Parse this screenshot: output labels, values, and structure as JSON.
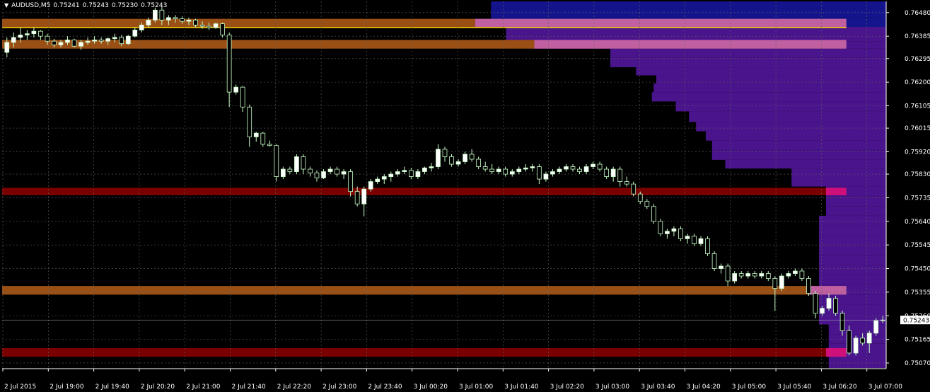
{
  "header": {
    "symbol_tf": "AUDUSD,M5",
    "open": "0.75241",
    "high": "0.75243",
    "low": "0.75230",
    "close": "0.75243",
    "dropdown_icon": "triangle-down-icon"
  },
  "colors": {
    "background": "#000000",
    "grid": "#606060",
    "axis_text": "#ffffff",
    "bull_body": "#ffffff",
    "bear_body": "#000000",
    "candle_wick": "#c8ffc8",
    "candle_outline": "#c8ffc8",
    "zone_orange": "#9a4f14",
    "zone_red": "#7a0000",
    "zone_pink": "#c060a0",
    "zone_magenta": "#d0107a",
    "profile_blue": "#14148c",
    "profile_purple": "#4a148c",
    "yellow_line": "#ffd700",
    "price_label_bg": "#ffffff"
  },
  "chart_data": {
    "type": "candlestick",
    "symbol": "AUDUSD",
    "timeframe": "M5",
    "ylim": [
      0.7505,
      0.76525
    ],
    "current_price": "0.75243",
    "y_ticks": [
      "0.76480",
      "0.76385",
      "0.76295",
      "0.76200",
      "0.76105",
      "0.76015",
      "0.75920",
      "0.75830",
      "0.75735",
      "0.75640",
      "0.75545",
      "0.75450",
      "0.75355",
      "0.75260",
      "0.75165",
      "0.75070"
    ],
    "x_ticks": [
      "2 Jul 2015",
      "2 Jul 19:00",
      "2 Jul 19:40",
      "2 Jul 20:20",
      "2 Jul 21:00",
      "2 Jul 21:40",
      "2 Jul 22:20",
      "2 Jul 23:00",
      "2 Jul 23:40",
      "3 Jul 00:20",
      "3 Jul 01:00",
      "3 Jul 01:40",
      "3 Jul 02:20",
      "3 Jul 03:00",
      "3 Jul 03:40",
      "3 Jul 04:20",
      "3 Jul 05:00",
      "3 Jul 05:40",
      "3 Jul 06:20",
      "3 Jul 07:00"
    ],
    "candles": [
      [
        0.7632,
        0.7638,
        0.763,
        0.7636
      ],
      [
        0.7636,
        0.764,
        0.7634,
        0.7638
      ],
      [
        0.7638,
        0.7642,
        0.7636,
        0.7639
      ],
      [
        0.7639,
        0.7641,
        0.7637,
        0.76395
      ],
      [
        0.76395,
        0.7642,
        0.7638,
        0.76405
      ],
      [
        0.76405,
        0.7641,
        0.7637,
        0.76385
      ],
      [
        0.76385,
        0.76395,
        0.7635,
        0.76365
      ],
      [
        0.76365,
        0.76375,
        0.7634,
        0.7635
      ],
      [
        0.7635,
        0.7637,
        0.7634,
        0.7636
      ],
      [
        0.7636,
        0.76385,
        0.7635,
        0.7637
      ],
      [
        0.7637,
        0.76375,
        0.7634,
        0.76345
      ],
      [
        0.76345,
        0.7637,
        0.7633,
        0.7636
      ],
      [
        0.7636,
        0.7638,
        0.7635,
        0.76365
      ],
      [
        0.76365,
        0.76385,
        0.76355,
        0.7637
      ],
      [
        0.7637,
        0.7638,
        0.76355,
        0.76365
      ],
      [
        0.76365,
        0.7638,
        0.7635,
        0.76375
      ],
      [
        0.76375,
        0.76395,
        0.7636,
        0.7638
      ],
      [
        0.7638,
        0.7639,
        0.76345,
        0.76355
      ],
      [
        0.76355,
        0.7639,
        0.7635,
        0.76385
      ],
      [
        0.76385,
        0.7642,
        0.7638,
        0.7641
      ],
      [
        0.7641,
        0.7644,
        0.764,
        0.7643
      ],
      [
        0.7643,
        0.7646,
        0.7642,
        0.7645
      ],
      [
        0.7645,
        0.765,
        0.7644,
        0.7649
      ],
      [
        0.7649,
        0.76505,
        0.7643,
        0.7645
      ],
      [
        0.7645,
        0.7647,
        0.7643,
        0.7646
      ],
      [
        0.7646,
        0.7647,
        0.7644,
        0.76455
      ],
      [
        0.76455,
        0.76465,
        0.76435,
        0.76445
      ],
      [
        0.76445,
        0.7646,
        0.7643,
        0.7645
      ],
      [
        0.7645,
        0.76455,
        0.7642,
        0.7643
      ],
      [
        0.7643,
        0.76445,
        0.76415,
        0.76425
      ],
      [
        0.76425,
        0.7644,
        0.7641,
        0.7642
      ],
      [
        0.7642,
        0.7644,
        0.76415,
        0.76435
      ],
      [
        0.76435,
        0.7644,
        0.7638,
        0.7639
      ],
      [
        0.7639,
        0.764,
        0.761,
        0.7616
      ],
      [
        0.7616,
        0.7619,
        0.7615,
        0.7618
      ],
      [
        0.7618,
        0.76185,
        0.7608,
        0.761
      ],
      [
        0.761,
        0.7611,
        0.7594,
        0.7598
      ],
      [
        0.7598,
        0.76,
        0.7596,
        0.75995
      ],
      [
        0.75995,
        0.76,
        0.7594,
        0.7595
      ],
      [
        0.7595,
        0.75965,
        0.7594,
        0.75945
      ],
      [
        0.75945,
        0.7595,
        0.758,
        0.7582
      ],
      [
        0.7582,
        0.7586,
        0.7581,
        0.7585
      ],
      [
        0.7585,
        0.7586,
        0.7583,
        0.7584
      ],
      [
        0.7584,
        0.7591,
        0.7583,
        0.759
      ],
      [
        0.759,
        0.7591,
        0.7583,
        0.7585
      ],
      [
        0.7585,
        0.7586,
        0.7582,
        0.75835
      ],
      [
        0.75835,
        0.75845,
        0.758,
        0.75815
      ],
      [
        0.75815,
        0.7585,
        0.7581,
        0.7584
      ],
      [
        0.7584,
        0.7586,
        0.7583,
        0.7585
      ],
      [
        0.7585,
        0.7586,
        0.7582,
        0.7583
      ],
      [
        0.7583,
        0.7585,
        0.7581,
        0.7584
      ],
      [
        0.7584,
        0.7585,
        0.7574,
        0.7576
      ],
      [
        0.7576,
        0.7578,
        0.757,
        0.7571
      ],
      [
        0.7571,
        0.7578,
        0.7566,
        0.7577
      ],
      [
        0.7577,
        0.7581,
        0.7576,
        0.758
      ],
      [
        0.758,
        0.7582,
        0.7579,
        0.7581
      ],
      [
        0.7581,
        0.7583,
        0.7579,
        0.7582
      ],
      [
        0.7582,
        0.7584,
        0.758,
        0.7583
      ],
      [
        0.7583,
        0.7585,
        0.7582,
        0.7584
      ],
      [
        0.7584,
        0.7586,
        0.7583,
        0.75845
      ],
      [
        0.75845,
        0.75855,
        0.7581,
        0.7582
      ],
      [
        0.7582,
        0.7585,
        0.7581,
        0.7584
      ],
      [
        0.7584,
        0.7586,
        0.7583,
        0.75855
      ],
      [
        0.75855,
        0.75875,
        0.7584,
        0.7586
      ],
      [
        0.7586,
        0.7595,
        0.7585,
        0.7593
      ],
      [
        0.7593,
        0.7594,
        0.7588,
        0.759
      ],
      [
        0.759,
        0.7591,
        0.7586,
        0.7587
      ],
      [
        0.7587,
        0.7589,
        0.7586,
        0.7588
      ],
      [
        0.7588,
        0.7592,
        0.7587,
        0.7591
      ],
      [
        0.7591,
        0.7593,
        0.7588,
        0.7589
      ],
      [
        0.7589,
        0.759,
        0.7585,
        0.7586
      ],
      [
        0.7586,
        0.7588,
        0.7584,
        0.7585
      ],
      [
        0.7585,
        0.7587,
        0.7583,
        0.7584
      ],
      [
        0.7584,
        0.7586,
        0.7583,
        0.7585
      ],
      [
        0.7585,
        0.7586,
        0.7582,
        0.7583
      ],
      [
        0.7583,
        0.7585,
        0.7582,
        0.7584
      ],
      [
        0.7584,
        0.7586,
        0.7583,
        0.7585
      ],
      [
        0.7585,
        0.7587,
        0.7584,
        0.75855
      ],
      [
        0.75855,
        0.7587,
        0.7584,
        0.7586
      ],
      [
        0.7586,
        0.7587,
        0.7579,
        0.7581
      ],
      [
        0.7581,
        0.7584,
        0.758,
        0.7583
      ],
      [
        0.7583,
        0.7585,
        0.7582,
        0.7584
      ],
      [
        0.7584,
        0.7586,
        0.7583,
        0.7585
      ],
      [
        0.7585,
        0.7587,
        0.7584,
        0.7586
      ],
      [
        0.7586,
        0.7587,
        0.7584,
        0.7585
      ],
      [
        0.7585,
        0.7586,
        0.7583,
        0.7584
      ],
      [
        0.7584,
        0.7587,
        0.7583,
        0.7586
      ],
      [
        0.7586,
        0.7588,
        0.7585,
        0.7587
      ],
      [
        0.7587,
        0.7588,
        0.7584,
        0.7585
      ],
      [
        0.7585,
        0.7586,
        0.7581,
        0.7582
      ],
      [
        0.7582,
        0.7586,
        0.758,
        0.7585
      ],
      [
        0.7585,
        0.7586,
        0.7578,
        0.758
      ],
      [
        0.758,
        0.7582,
        0.7578,
        0.7579
      ],
      [
        0.7579,
        0.758,
        0.7574,
        0.7575
      ],
      [
        0.7575,
        0.7576,
        0.7571,
        0.7572
      ],
      [
        0.7572,
        0.7573,
        0.7569,
        0.757
      ],
      [
        0.757,
        0.7571,
        0.7563,
        0.7564
      ],
      [
        0.7564,
        0.7565,
        0.7558,
        0.7559
      ],
      [
        0.7559,
        0.7561,
        0.7557,
        0.756
      ],
      [
        0.756,
        0.7562,
        0.7558,
        0.7561
      ],
      [
        0.7561,
        0.7562,
        0.7556,
        0.7557
      ],
      [
        0.7557,
        0.7559,
        0.7555,
        0.7558
      ],
      [
        0.7558,
        0.7559,
        0.7554,
        0.7555
      ],
      [
        0.7555,
        0.7558,
        0.7554,
        0.7557
      ],
      [
        0.7557,
        0.7558,
        0.755,
        0.7551
      ],
      [
        0.7551,
        0.7552,
        0.7544,
        0.7545
      ],
      [
        0.7545,
        0.7547,
        0.7543,
        0.7546
      ],
      [
        0.7546,
        0.7547,
        0.7538,
        0.754
      ],
      [
        0.754,
        0.7544,
        0.7539,
        0.7543
      ],
      [
        0.7543,
        0.7544,
        0.7541,
        0.7542
      ],
      [
        0.7542,
        0.7544,
        0.7541,
        0.7543
      ],
      [
        0.7543,
        0.7544,
        0.7541,
        0.7542
      ],
      [
        0.7542,
        0.7544,
        0.7541,
        0.7543
      ],
      [
        0.7543,
        0.7544,
        0.754,
        0.7541
      ],
      [
        0.7541,
        0.7542,
        0.7528,
        0.7537
      ],
      [
        0.7537,
        0.7543,
        0.7536,
        0.7542
      ],
      [
        0.7542,
        0.7544,
        0.7541,
        0.7543
      ],
      [
        0.7543,
        0.7545,
        0.7542,
        0.7544
      ],
      [
        0.7544,
        0.7545,
        0.754,
        0.7541
      ],
      [
        0.7541,
        0.7542,
        0.7534,
        0.7535
      ],
      [
        0.7535,
        0.7536,
        0.7525,
        0.7527
      ],
      [
        0.7527,
        0.753,
        0.7526,
        0.7529
      ],
      [
        0.7529,
        0.7535,
        0.7528,
        0.7533
      ],
      [
        0.7533,
        0.7534,
        0.7526,
        0.7527
      ],
      [
        0.7527,
        0.7528,
        0.7518,
        0.752
      ],
      [
        0.752,
        0.7522,
        0.751,
        0.7511
      ],
      [
        0.7511,
        0.7518,
        0.751,
        0.7517
      ],
      [
        0.7517,
        0.7519,
        0.7514,
        0.7515
      ],
      [
        0.7515,
        0.752,
        0.7511,
        0.7519
      ],
      [
        0.7519,
        0.7525,
        0.7518,
        0.7524
      ],
      [
        0.7524,
        0.7526,
        0.7523,
        0.75243
      ]
    ],
    "zones": [
      {
        "kind": "orange",
        "price_top": 0.76455,
        "price_bottom": 0.7642,
        "x_end": 0.535
      },
      {
        "kind": "pink",
        "price_top": 0.76455,
        "price_bottom": 0.7642,
        "x_start": 0.535,
        "x_end": 0.955
      },
      {
        "kind": "orange",
        "price_top": 0.7637,
        "price_bottom": 0.76335,
        "x_end": 0.602
      },
      {
        "kind": "pink",
        "price_top": 0.7637,
        "price_bottom": 0.76335,
        "x_start": 0.602,
        "x_end": 0.955
      },
      {
        "kind": "red",
        "price_top": 0.75775,
        "price_bottom": 0.75745,
        "x_end": 0.932
      },
      {
        "kind": "magenta",
        "price_top": 0.75775,
        "price_bottom": 0.75745,
        "x_start": 0.932,
        "x_end": 0.955
      },
      {
        "kind": "orange",
        "price_top": 0.7538,
        "price_bottom": 0.75345,
        "x_end": 0.912
      },
      {
        "kind": "pink",
        "price_top": 0.7538,
        "price_bottom": 0.75345,
        "x_start": 0.912,
        "x_end": 0.955
      },
      {
        "kind": "red",
        "price_top": 0.7513,
        "price_bottom": 0.75095,
        "x_end": 0.932
      },
      {
        "kind": "magenta",
        "price_top": 0.7513,
        "price_bottom": 0.75095,
        "x_start": 0.932,
        "x_end": 0.955
      }
    ],
    "yellow_line_price": 0.7642,
    "volume_profile": [
      {
        "price": 0.7651,
        "left": 0.553,
        "color": "blue"
      },
      {
        "price": 0.7648,
        "left": 0.553,
        "color": "blue"
      },
      {
        "price": 0.7644,
        "left": 0.553,
        "color": "blue"
      },
      {
        "price": 0.76405,
        "left": 0.57,
        "color": "purple"
      },
      {
        "price": 0.7638,
        "left": 0.57,
        "color": "purple"
      },
      {
        "price": 0.7635,
        "left": 0.602,
        "color": "purple"
      },
      {
        "price": 0.7632,
        "left": 0.688,
        "color": "purple"
      },
      {
        "price": 0.76275,
        "left": 0.688,
        "color": "purple"
      },
      {
        "price": 0.76245,
        "left": 0.717,
        "color": "purple"
      },
      {
        "price": 0.7621,
        "left": 0.74,
        "color": "purple"
      },
      {
        "price": 0.7618,
        "left": 0.737,
        "color": "purple"
      },
      {
        "price": 0.7614,
        "left": 0.735,
        "color": "purple"
      },
      {
        "price": 0.76105,
        "left": 0.762,
        "color": "purple"
      },
      {
        "price": 0.7606,
        "left": 0.777,
        "color": "purple"
      },
      {
        "price": 0.7602,
        "left": 0.785,
        "color": "purple"
      },
      {
        "price": 0.75985,
        "left": 0.796,
        "color": "purple"
      },
      {
        "price": 0.75945,
        "left": 0.803,
        "color": "purple"
      },
      {
        "price": 0.75905,
        "left": 0.803,
        "color": "purple"
      },
      {
        "price": 0.7587,
        "left": 0.818,
        "color": "purple"
      },
      {
        "price": 0.75835,
        "left": 0.893,
        "color": "purple"
      },
      {
        "price": 0.758,
        "left": 0.893,
        "color": "purple"
      },
      {
        "price": 0.7576,
        "left": 0.932,
        "color": "purple"
      },
      {
        "price": 0.7572,
        "left": 0.932,
        "color": "purple"
      },
      {
        "price": 0.7568,
        "left": 0.932,
        "color": "purple"
      },
      {
        "price": 0.75645,
        "left": 0.924,
        "color": "purple"
      },
      {
        "price": 0.75605,
        "left": 0.924,
        "color": "purple"
      },
      {
        "price": 0.75565,
        "left": 0.924,
        "color": "purple"
      },
      {
        "price": 0.75525,
        "left": 0.924,
        "color": "purple"
      },
      {
        "price": 0.75485,
        "left": 0.924,
        "color": "purple"
      },
      {
        "price": 0.75445,
        "left": 0.924,
        "color": "purple"
      },
      {
        "price": 0.75405,
        "left": 0.924,
        "color": "purple"
      },
      {
        "price": 0.75365,
        "left": 0.924,
        "color": "purple"
      },
      {
        "price": 0.75325,
        "left": 0.924,
        "color": "purple"
      },
      {
        "price": 0.75285,
        "left": 0.924,
        "color": "purple"
      },
      {
        "price": 0.75245,
        "left": 0.924,
        "color": "purple"
      },
      {
        "price": 0.75205,
        "left": 0.935,
        "color": "purple"
      },
      {
        "price": 0.75165,
        "left": 0.935,
        "color": "purple"
      },
      {
        "price": 0.7513,
        "left": 0.935,
        "color": "purple"
      }
    ]
  }
}
